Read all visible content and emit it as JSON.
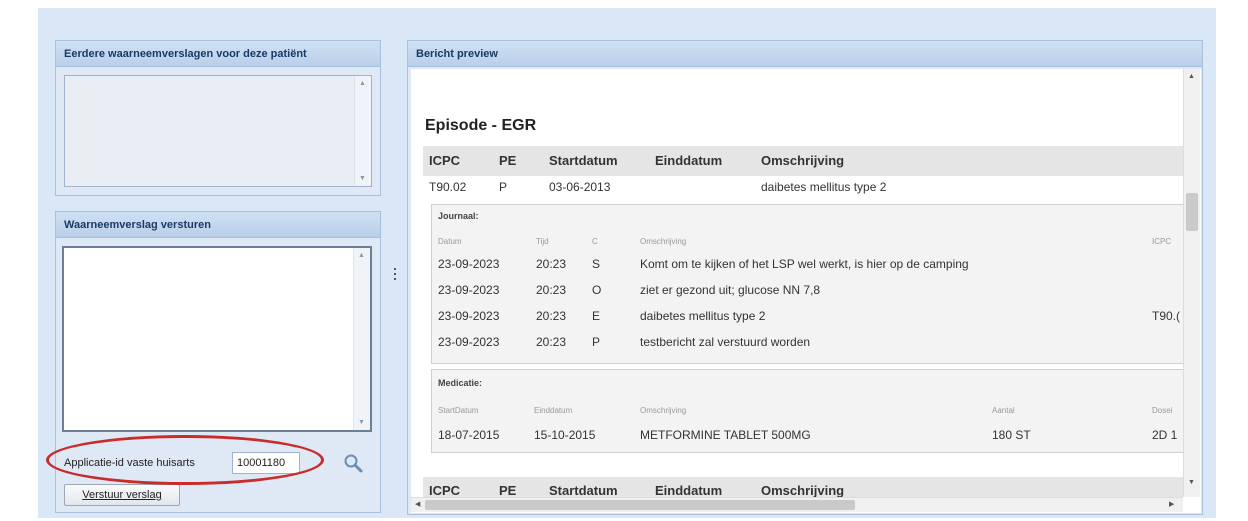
{
  "panels": {
    "previous_reports": {
      "title": "Eerdere waarneemverslagen voor deze patiënt"
    },
    "send_report": {
      "title": "Waarneemverslag versturen",
      "textarea_value": "",
      "app_id_label": "Applicatie-id vaste huisarts",
      "app_id_value": "10001180",
      "send_button_label": "Verstuur verslag"
    },
    "preview": {
      "title": "Bericht preview"
    }
  },
  "episode": {
    "title": "Episode - EGR",
    "columns": [
      "ICPC",
      "PE",
      "Startdatum",
      "Einddatum",
      "Omschrijving"
    ],
    "row": {
      "icpc": "T90.02",
      "pe": "P",
      "start": "03-06-2013",
      "end": "",
      "desc": "daibetes mellitus type 2"
    }
  },
  "journal": {
    "title": "Journaal:",
    "columns": [
      "Datum",
      "Tijd",
      "C",
      "Omschrijving",
      "ICPC"
    ],
    "rows": [
      {
        "date": "23-09-2023",
        "time": "20:23",
        "c": "S",
        "desc": "Komt om te kijken of het LSP wel werkt, is hier op de camping",
        "icpc": ""
      },
      {
        "date": "23-09-2023",
        "time": "20:23",
        "c": "O",
        "desc": "ziet er gezond uit; glucose NN 7,8",
        "icpc": ""
      },
      {
        "date": "23-09-2023",
        "time": "20:23",
        "c": "E",
        "desc": "daibetes mellitus type 2",
        "icpc": "T90.("
      },
      {
        "date": "23-09-2023",
        "time": "20:23",
        "c": "P",
        "desc": "testbericht zal verstuurd worden",
        "icpc": ""
      }
    ]
  },
  "medication": {
    "title": "Medicatie:",
    "columns": [
      "StartDatum",
      "Einddatum",
      "Omschrijving",
      "Aantal",
      "Dosei"
    ],
    "rows": [
      {
        "start": "18-07-2015",
        "end": "15-10-2015",
        "desc": "METFORMINE TABLET 500MG",
        "count": "180 ST",
        "dose": "2D 1"
      }
    ]
  },
  "episode2_columns": [
    "ICPC",
    "PE",
    "Startdatum",
    "Einddatum",
    "Omschrijving"
  ],
  "icons": {
    "search": "magnifier-icon",
    "splitter": "splitter-icon"
  },
  "colors": {
    "accent_oval": "#c92a2a",
    "panel_header": "#b9cfe9",
    "background": "#d9e7f7"
  }
}
